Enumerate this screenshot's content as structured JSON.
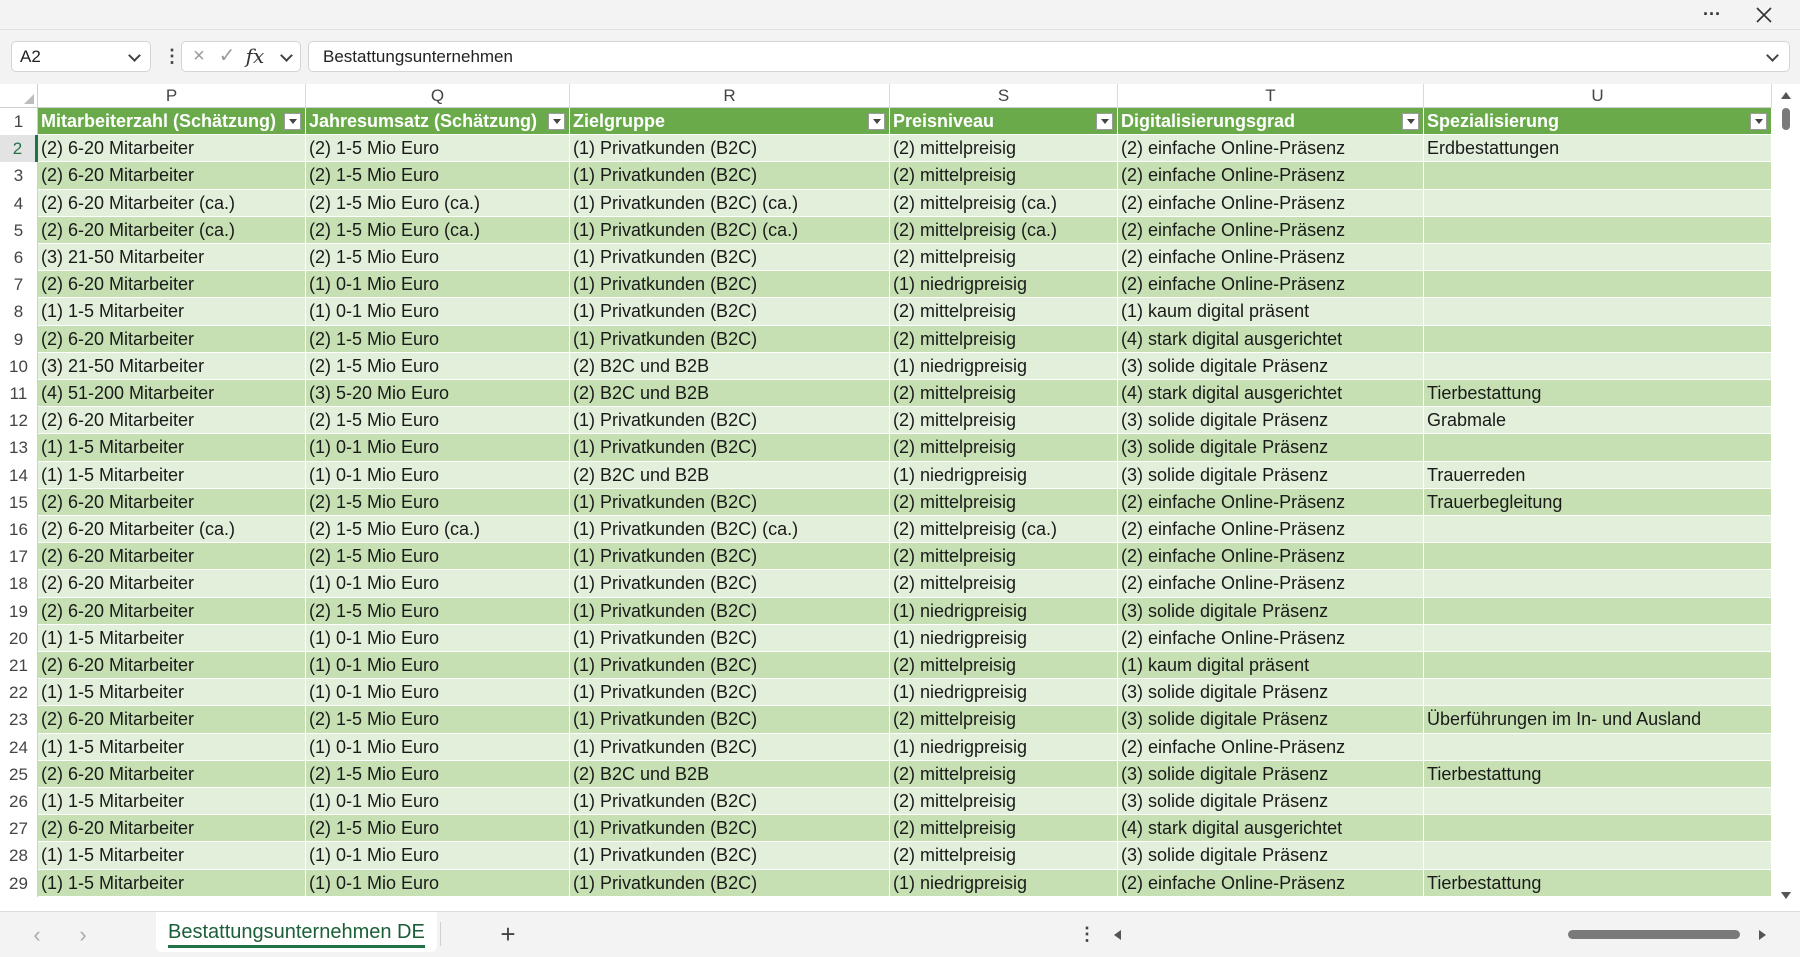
{
  "window": {
    "more_icon": "ellipsis-icon",
    "close_icon": "close-icon"
  },
  "formula_bar": {
    "name_box": "A2",
    "cancel_icon": "×",
    "enter_icon": "✓",
    "fx_label": "fx",
    "content": "Bestattungsunternehmen"
  },
  "columns": [
    "P",
    "Q",
    "R",
    "S",
    "T",
    "U"
  ],
  "headers": [
    "Mitarbeiterzahl (Schätzung)",
    "Jahresumsatz (Schätzung)",
    "Zielgruppe",
    "Preisniveau",
    "Digitalisierungsgrad",
    "Spezialisierung"
  ],
  "rows": [
    {
      "n": "2",
      "c": [
        "(2) 6-20 Mitarbeiter",
        "(2) 1-5 Mio Euro",
        "(1) Privatkunden (B2C)",
        "(2) mittelpreisig",
        "(2) einfache Online-Präsenz",
        "Erdbestattungen"
      ]
    },
    {
      "n": "3",
      "c": [
        "(2) 6-20 Mitarbeiter",
        "(2) 1-5 Mio Euro",
        "(1) Privatkunden (B2C)",
        "(2) mittelpreisig",
        "(2) einfache Online-Präsenz",
        ""
      ]
    },
    {
      "n": "4",
      "c": [
        "(2) 6-20 Mitarbeiter (ca.)",
        "(2) 1-5 Mio Euro (ca.)",
        "(1) Privatkunden (B2C) (ca.)",
        "(2) mittelpreisig (ca.)",
        "(2) einfache Online-Präsenz",
        ""
      ]
    },
    {
      "n": "5",
      "c": [
        "(2) 6-20 Mitarbeiter (ca.)",
        "(2) 1-5 Mio Euro (ca.)",
        "(1) Privatkunden (B2C) (ca.)",
        "(2) mittelpreisig (ca.)",
        "(2) einfache Online-Präsenz",
        ""
      ]
    },
    {
      "n": "6",
      "c": [
        "(3) 21-50 Mitarbeiter",
        "(2) 1-5 Mio Euro",
        "(1) Privatkunden (B2C)",
        "(2) mittelpreisig",
        "(2) einfache Online-Präsenz",
        ""
      ]
    },
    {
      "n": "7",
      "c": [
        "(2) 6-20 Mitarbeiter",
        "(1) 0-1 Mio Euro",
        "(1) Privatkunden (B2C)",
        "(1) niedrigpreisig",
        "(2) einfache Online-Präsenz",
        ""
      ]
    },
    {
      "n": "8",
      "c": [
        "(1) 1-5 Mitarbeiter",
        "(1) 0-1 Mio Euro",
        "(1) Privatkunden (B2C)",
        "(2) mittelpreisig",
        "(1) kaum digital präsent",
        ""
      ]
    },
    {
      "n": "9",
      "c": [
        "(2) 6-20 Mitarbeiter",
        "(2) 1-5 Mio Euro",
        "(1) Privatkunden (B2C)",
        "(2) mittelpreisig",
        "(4) stark digital ausgerichtet",
        ""
      ]
    },
    {
      "n": "10",
      "c": [
        "(3) 21-50 Mitarbeiter",
        "(2) 1-5 Mio Euro",
        "(2) B2C und B2B",
        "(1) niedrigpreisig",
        "(3) solide digitale Präsenz",
        ""
      ]
    },
    {
      "n": "11",
      "c": [
        "(4) 51-200 Mitarbeiter",
        "(3) 5-20 Mio Euro",
        "(2) B2C und B2B",
        "(2) mittelpreisig",
        "(4) stark digital ausgerichtet",
        "Tierbestattung"
      ]
    },
    {
      "n": "12",
      "c": [
        "(2) 6-20 Mitarbeiter",
        "(2) 1-5 Mio Euro",
        "(1) Privatkunden (B2C)",
        "(2) mittelpreisig",
        "(3) solide digitale Präsenz",
        "Grabmale"
      ]
    },
    {
      "n": "13",
      "c": [
        "(1) 1-5 Mitarbeiter",
        "(1) 0-1 Mio Euro",
        "(1) Privatkunden (B2C)",
        "(2) mittelpreisig",
        "(3) solide digitale Präsenz",
        ""
      ]
    },
    {
      "n": "14",
      "c": [
        "(1) 1-5 Mitarbeiter",
        "(1) 0-1 Mio Euro",
        "(2) B2C und B2B",
        "(1) niedrigpreisig",
        "(3) solide digitale Präsenz",
        "Trauerreden"
      ]
    },
    {
      "n": "15",
      "c": [
        "(2) 6-20 Mitarbeiter",
        "(2) 1-5 Mio Euro",
        "(1) Privatkunden (B2C)",
        "(2) mittelpreisig",
        "(2) einfache Online-Präsenz",
        "Trauerbegleitung"
      ]
    },
    {
      "n": "16",
      "c": [
        "(2) 6-20 Mitarbeiter (ca.)",
        "(2) 1-5 Mio Euro (ca.)",
        "(1) Privatkunden (B2C) (ca.)",
        "(2) mittelpreisig (ca.)",
        "(2) einfache Online-Präsenz",
        ""
      ]
    },
    {
      "n": "17",
      "c": [
        "(2) 6-20 Mitarbeiter",
        "(2) 1-5 Mio Euro",
        "(1) Privatkunden (B2C)",
        "(2) mittelpreisig",
        "(2) einfache Online-Präsenz",
        ""
      ]
    },
    {
      "n": "18",
      "c": [
        "(2) 6-20 Mitarbeiter",
        "(1) 0-1 Mio Euro",
        "(1) Privatkunden (B2C)",
        "(2) mittelpreisig",
        "(2) einfache Online-Präsenz",
        ""
      ]
    },
    {
      "n": "19",
      "c": [
        "(2) 6-20 Mitarbeiter",
        "(2) 1-5 Mio Euro",
        "(1) Privatkunden (B2C)",
        "(1) niedrigpreisig",
        "(3) solide digitale Präsenz",
        ""
      ]
    },
    {
      "n": "20",
      "c": [
        "(1) 1-5 Mitarbeiter",
        "(1) 0-1 Mio Euro",
        "(1) Privatkunden (B2C)",
        "(1) niedrigpreisig",
        "(2) einfache Online-Präsenz",
        ""
      ]
    },
    {
      "n": "21",
      "c": [
        "(2) 6-20 Mitarbeiter",
        "(1) 0-1 Mio Euro",
        "(1) Privatkunden (B2C)",
        "(2) mittelpreisig",
        "(1) kaum digital präsent",
        ""
      ]
    },
    {
      "n": "22",
      "c": [
        "(1) 1-5 Mitarbeiter",
        "(1) 0-1 Mio Euro",
        "(1) Privatkunden (B2C)",
        "(1) niedrigpreisig",
        "(3) solide digitale Präsenz",
        ""
      ]
    },
    {
      "n": "23",
      "c": [
        "(2) 6-20 Mitarbeiter",
        "(2) 1-5 Mio Euro",
        "(1) Privatkunden (B2C)",
        "(2) mittelpreisig",
        "(3) solide digitale Präsenz",
        "Überführungen im In- und Ausland"
      ]
    },
    {
      "n": "24",
      "c": [
        "(1) 1-5 Mitarbeiter",
        "(1) 0-1 Mio Euro",
        "(1) Privatkunden (B2C)",
        "(1) niedrigpreisig",
        "(2) einfache Online-Präsenz",
        ""
      ]
    },
    {
      "n": "25",
      "c": [
        "(2) 6-20 Mitarbeiter",
        "(2) 1-5 Mio Euro",
        "(2) B2C und B2B",
        "(2) mittelpreisig",
        "(3) solide digitale Präsenz",
        "Tierbestattung"
      ]
    },
    {
      "n": "26",
      "c": [
        "(1) 1-5 Mitarbeiter",
        "(1) 0-1 Mio Euro",
        "(1) Privatkunden (B2C)",
        "(2) mittelpreisig",
        "(3) solide digitale Präsenz",
        ""
      ]
    },
    {
      "n": "27",
      "c": [
        "(2) 6-20 Mitarbeiter",
        "(2) 1-5 Mio Euro",
        "(1) Privatkunden (B2C)",
        "(2) mittelpreisig",
        "(4) stark digital ausgerichtet",
        ""
      ]
    },
    {
      "n": "28",
      "c": [
        "(1) 1-5 Mitarbeiter",
        "(1) 0-1 Mio Euro",
        "(1) Privatkunden (B2C)",
        "(2) mittelpreisig",
        "(3) solide digitale Präsenz",
        ""
      ]
    },
    {
      "n": "29",
      "c": [
        "(1) 1-5 Mitarbeiter",
        "(1) 0-1 Mio Euro",
        "(1) Privatkunden (B2C)",
        "(1) niedrigpreisig",
        "(2) einfache Online-Präsenz",
        "Tierbestattung"
      ]
    }
  ],
  "sheet_tab": "Bestattungsunternehmen DE",
  "add_sheet": "+",
  "nav": {
    "prev": "‹",
    "next": "›"
  }
}
